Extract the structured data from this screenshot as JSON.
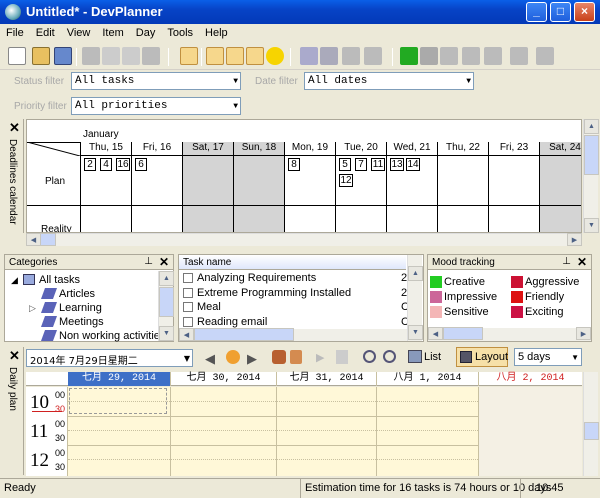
{
  "window": {
    "title": "Untitled* - DevPlanner",
    "min": "_",
    "max": "□",
    "close": "×"
  },
  "menu": [
    "File",
    "Edit",
    "View",
    "Item",
    "Day",
    "Tools",
    "Help"
  ],
  "filters": {
    "status_label": "Status filter",
    "status_value": "All tasks",
    "date_label": "Date filter",
    "date_value": "All dates",
    "priority_label": "Priority filter",
    "priority_value": "All priorities"
  },
  "deadlines": {
    "tab_label": "Deadlines calendar",
    "month": "January",
    "days": [
      "Thu, 15",
      "Fri, 16",
      "Sat, 17",
      "Sun, 18",
      "Mon, 19",
      "Tue, 20",
      "Wed, 21",
      "Thu, 22",
      "Fri, 23",
      "Sat, 24"
    ],
    "rows": [
      "Plan",
      "Reality"
    ],
    "tasks": {
      "thu15": [
        "2",
        "4",
        "16"
      ],
      "fri16": [
        "6"
      ],
      "mon19": [
        "8"
      ],
      "tue20": [
        "5",
        "7",
        "11",
        "12"
      ],
      "wed21": [
        "13",
        "14"
      ]
    }
  },
  "categories": {
    "title": "Categories",
    "items": [
      "All tasks",
      "Articles",
      "Learning",
      "Meetings",
      "Non working activities"
    ]
  },
  "tasks": {
    "header": "Task name",
    "items": [
      "Analyzing Requirements",
      "Extreme Programming Installed",
      "Meal",
      "Reading email"
    ],
    "edge": [
      "2",
      "2",
      "C",
      "C"
    ]
  },
  "mood": {
    "title": "Mood tracking",
    "items": [
      {
        "label": "Creative",
        "color": "#22cc22"
      },
      {
        "label": "Aggressive",
        "color": "#cc1133"
      },
      {
        "label": "Impressive",
        "color": "#cc6699"
      },
      {
        "label": "Friendly",
        "color": "#dd1111"
      },
      {
        "label": "Sensitive",
        "color": "#f4b6b6"
      },
      {
        "label": "Exciting",
        "color": "#cc1144"
      }
    ]
  },
  "daily": {
    "tab_label": "Daily plan",
    "date_value": "2014年 7月29日星期二",
    "list_label": "List",
    "layout_label": "Layout",
    "range_value": "5 days",
    "columns": [
      "七月 29, 2014",
      "七月 30, 2014",
      "七月 31, 2014",
      "八月 1, 2014",
      "八月 2, 2014"
    ],
    "hours": [
      "10",
      "11",
      "12"
    ],
    "minutes": [
      "00",
      "30"
    ]
  },
  "status": {
    "left": "Ready",
    "middle": "Estimation time for 16 tasks is 74 hours or 10 days",
    "time": "10:45"
  }
}
